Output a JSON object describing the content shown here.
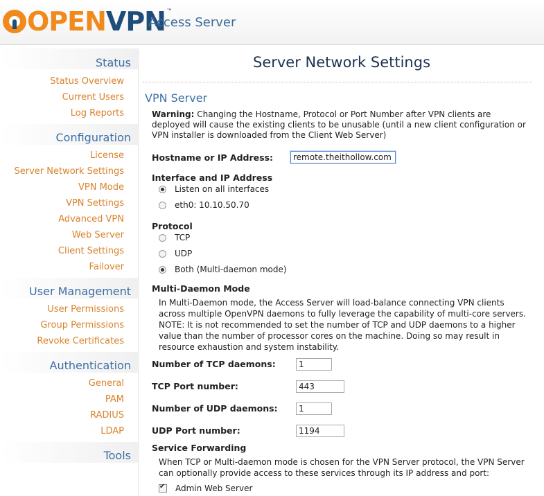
{
  "header": {
    "logo_open": "OPEN",
    "logo_vpn": "VPN",
    "logo_tm": "™",
    "product": "Access Server"
  },
  "sidebar": {
    "sections": [
      {
        "title": "Status",
        "items": [
          "Status Overview",
          "Current Users",
          "Log Reports"
        ]
      },
      {
        "title": "Configuration",
        "items": [
          "License",
          "Server Network Settings",
          "VPN Mode",
          "VPN Settings",
          "Advanced VPN",
          "Web Server",
          "Client Settings",
          "Failover"
        ]
      },
      {
        "title": "User Management",
        "items": [
          "User Permissions",
          "Group Permissions",
          "Revoke Certificates"
        ]
      },
      {
        "title": "Authentication",
        "items": [
          "General",
          "PAM",
          "RADIUS",
          "LDAP"
        ]
      },
      {
        "title": "Tools",
        "items": []
      }
    ]
  },
  "main": {
    "page_title": "Server Network Settings",
    "section_title": "VPN Server",
    "warning_label": "Warning:",
    "warning_text": " Changing the Hostname, Protocol or Port Number after VPN clients are deployed will cause the existing clients to be unusable (until a new client configuration or VPN installer is downloaded from the Client Web Server)",
    "hostname_label": "Hostname or IP Address:",
    "hostname_value": "remote.theithollow.com",
    "interface_label": "Interface and IP Address",
    "interfaces": [
      {
        "label": "Listen on all interfaces",
        "selected": true
      },
      {
        "label": "eth0: 10.10.50.70",
        "selected": false
      }
    ],
    "protocol_label": "Protocol",
    "protocols": [
      {
        "label": "TCP",
        "selected": false
      },
      {
        "label": "UDP",
        "selected": false
      },
      {
        "label": "Both (Multi-daemon mode)",
        "selected": true
      }
    ],
    "multi_daemon_label": "Multi-Daemon Mode",
    "multi_daemon_text": "In Multi-Daemon mode, the Access Server will load-balance connecting VPN clients across multiple OpenVPN daemons to fully leverage the capability of multi-core servers. NOTE: It is not recommended to set the number of TCP and UDP daemons to a higher value than the number of processor cores on the machine. Doing so may result in resource exhaustion and system instability.",
    "tcp_daemons_label": "Number of TCP daemons:",
    "tcp_daemons_value": "1",
    "tcp_port_label": "TCP Port number:",
    "tcp_port_value": "443",
    "udp_daemons_label": "Number of UDP daemons:",
    "udp_daemons_value": "1",
    "udp_port_label": "UDP Port number:",
    "udp_port_value": "1194",
    "service_forwarding_label": "Service Forwarding",
    "service_forwarding_text": "When TCP or Multi-daemon mode is chosen for the VPN Server protocol, the VPN Server can optionally provide access to these services through its IP address and port:",
    "admin_web_server_label": "Admin Web Server",
    "admin_web_server_checked": true
  },
  "colors": {
    "brand_orange": "#f08a1c",
    "brand_blue": "#1f4d7a",
    "section_blue": "#3b6ea5",
    "nav_orange": "#d9822b"
  }
}
